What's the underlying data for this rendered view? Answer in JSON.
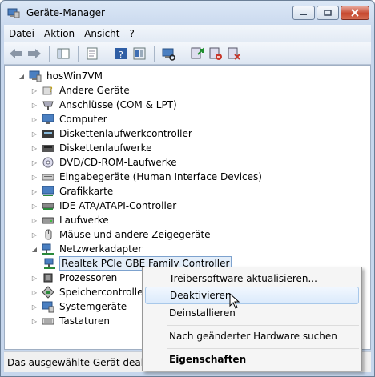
{
  "window": {
    "title": "Geräte-Manager"
  },
  "menu": [
    "Datei",
    "Aktion",
    "Ansicht",
    "?"
  ],
  "toolbar_icons": [
    "back-arrow-icon",
    "forward-arrow-icon",
    "console-tree-icon",
    "properties-icon",
    "help-icon",
    "show-list-icon",
    "scan-hardware-icon",
    "update-driver-icon",
    "disable-device-icon",
    "uninstall-device-icon"
  ],
  "tree": {
    "root": "hosWin7VM",
    "categories": [
      "Andere Geräte",
      "Anschlüsse (COM & LPT)",
      "Computer",
      "Diskettenlaufwerkcontroller",
      "Diskettenlaufwerke",
      "DVD/CD-ROM-Laufwerke",
      "Eingabegeräte (Human Interface Devices)",
      "Grafikkarte",
      "IDE ATA/ATAPI-Controller",
      "Laufwerke",
      "Mäuse und andere Zeigegeräte",
      "Netzwerkadapter",
      "Realtek PCIe GBE Family Controller",
      "Prozessoren",
      "Speichercontroller",
      "Systemgeräte",
      "Tastaturen"
    ]
  },
  "status": "Das ausgewählte Gerät deaktivie",
  "context_menu": {
    "update": "Treibersoftware aktualisieren...",
    "disable": "Deaktivieren",
    "uninstall": "Deinstallieren",
    "scan": "Nach geänderter Hardware suchen",
    "properties": "Eigenschaften"
  }
}
